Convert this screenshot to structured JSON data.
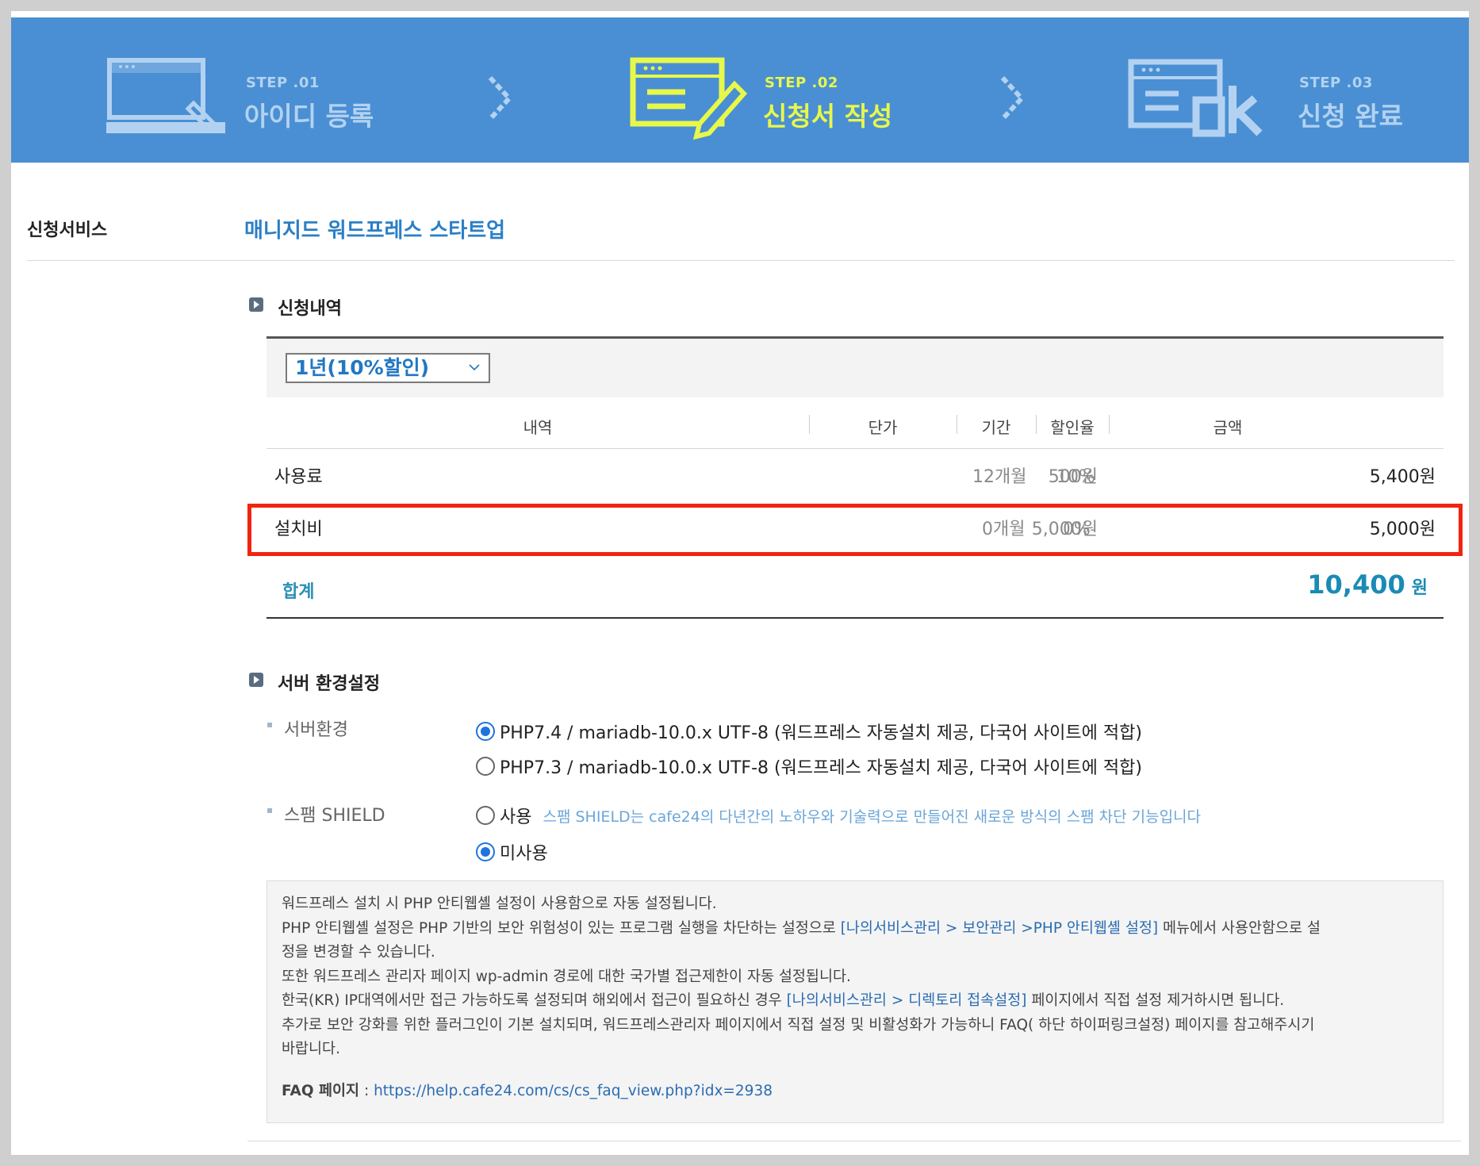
{
  "steps": [
    {
      "num": "STEP .01",
      "label": "아이디 등록",
      "state": "done",
      "icon": "window-pencil-icon"
    },
    {
      "num": "STEP .02",
      "label": "신청서 작성",
      "state": "active",
      "icon": "window-pencil-icon"
    },
    {
      "num": "STEP .03",
      "label": "신청 완료",
      "state": "pending",
      "icon": "window-ok-icon"
    }
  ],
  "service": {
    "label": "신청서비스",
    "name": "매니지드 워드프레스 스타트업"
  },
  "order": {
    "section_title": "신청내역",
    "period_select": "1년(10%할인)",
    "headers": {
      "item": "내역",
      "unit_price": "단가",
      "period": "기간",
      "discount": "할인율",
      "amount": "금액"
    },
    "rows": [
      {
        "item": "사용료",
        "unit_price": "500원",
        "period": "12개월",
        "discount": "10%",
        "amount": "5,400원"
      },
      {
        "item": "설치비",
        "unit_price": "5,000원",
        "period": "0개월",
        "discount": "0%",
        "amount": "5,000원"
      }
    ],
    "total_label": "합계",
    "total_value": "10,400",
    "total_unit": "원"
  },
  "server": {
    "section_title": "서버 환경설정",
    "env_label": "서버환경",
    "env_options": [
      {
        "label": "PHP7.4 / mariadb-10.0.x UTF-8 (워드프레스 자동설치 제공, 다국어 사이트에 적합)",
        "selected": true
      },
      {
        "label": "PHP7.3 / mariadb-10.0.x UTF-8 (워드프레스 자동설치 제공, 다국어 사이트에 적합)",
        "selected": false
      }
    ],
    "spam_label": "스팸 SHIELD",
    "spam_options": [
      {
        "label": "사용",
        "selected": false
      },
      {
        "label": "미사용",
        "selected": true
      }
    ],
    "spam_desc": "스팸 SHIELD는 cafe24의 다년간의 노하우와 기술력으로 만들어진 새로운 방식의 스팸 차단 기능입니다"
  },
  "notice": {
    "line1": "워드프레스 설치 시 PHP 안티웹셸 설정이 사용함으로 자동 설정됩니다.",
    "line2a": "PHP 안티웹셸 설정은 PHP 기반의 보안 위험성이 있는 프로그램 실행을 차단하는 설정으로 ",
    "line2_link": "[나의서비스관리 > 보안관리 >PHP 안티웹셸 설정]",
    "line2b": " 메뉴에서 사용안함으로 설",
    "line3": "정을 변경할 수 있습니다.",
    "line4": "또한 워드프레스 관리자 페이지 wp-admin 경로에 대한 국가별 접근제한이 자동 설정됩니다.",
    "line5a": "한국(KR) IP대역에서만 접근 가능하도록 설정되며 해외에서 접근이 필요하신 경우 ",
    "line5_link": "[나의서비스관리 > 디렉토리 접속설정]",
    "line5b": " 페이지에서 직접 설정 제거하시면 됩니다.",
    "line6": "추가로 보안 강화를 위한 플러그인이 기본 설치되며, 워드프레스관리자 페이지에서 직접 설정 및 비활성화가 가능하니 FAQ( 하단 하이퍼링크설정) 페이지를 참고해주시기",
    "line7": "바랍니다.",
    "faq_label": "FAQ 페이지",
    "faq_sep": " : ",
    "faq_url": "https://help.cafe24.com/cs/cs_faq_view.php?idx=2938"
  },
  "colors": {
    "banner": "#4a8fd3",
    "active_step": "#e8f84a",
    "accent": "#2b7fc6",
    "highlight": "#f22410"
  }
}
